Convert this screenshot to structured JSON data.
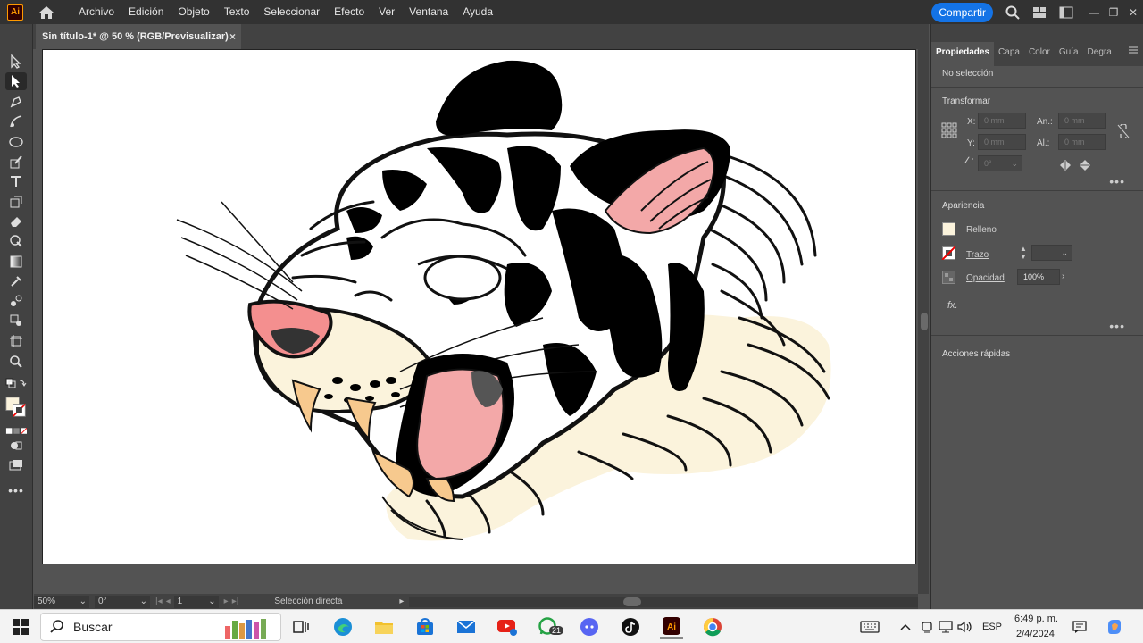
{
  "app": {
    "logo_text": "Ai",
    "menus": [
      "Archivo",
      "Edición",
      "Objeto",
      "Texto",
      "Seleccionar",
      "Efecto",
      "Ver",
      "Ventana",
      "Ayuda"
    ],
    "share_label": "Compartir"
  },
  "document": {
    "tab_title": "Sin título-1* @ 50 % (RGB/Previsualizar)",
    "close_symbol": "×"
  },
  "statusbar": {
    "zoom": "50%",
    "rotation": "0°",
    "artboard_number": "1",
    "tool_name": "Selección directa"
  },
  "panel": {
    "tabs": [
      "Propiedades",
      "Capa",
      "Color",
      "Guía",
      "Degra"
    ],
    "selection_status": "No selección",
    "transform": {
      "title": "Transformar",
      "x_label": "X:",
      "y_label": "Y:",
      "w_label": "An.:",
      "h_label": "Al.:",
      "x_value": "0 mm",
      "y_value": "0 mm",
      "w_value": "0 mm",
      "h_value": "0 mm",
      "angle_value": "0°"
    },
    "appearance": {
      "title": "Apariencia",
      "fill_label": "Relleno",
      "stroke_label": "Trazo",
      "opacity_label": "Opacidad",
      "opacity_value": "100%",
      "fx_label": "fx."
    },
    "quick_actions_title": "Acciones rápidas",
    "more": "•••"
  },
  "taskbar": {
    "search_placeholder": "Buscar",
    "whatsapp_badge": "21",
    "language": "ESP",
    "time": "6:49 p. m.",
    "date": "2/4/2024"
  },
  "colors": {
    "accent_blue": "#1473e6",
    "fill_swatch": "#fbf3dc",
    "tiger_pink": "#f3a8a8",
    "tiger_cream": "#fbf3dc",
    "fang_tan": "#f7c98e"
  }
}
